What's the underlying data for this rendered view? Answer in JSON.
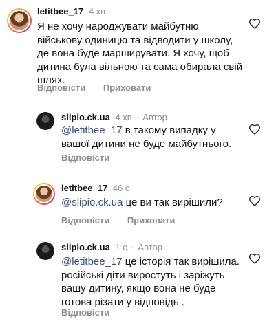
{
  "comments": [
    {
      "username": "letitbee_17",
      "time": "4 хв",
      "author_label": "",
      "text": "Я не хочу народжувати майбутню військову одиницю та відводити у школу, де вона буде марширувати. Я хочу, щоб дитина була вільною та сама обирала свій шлях.",
      "reply": "Відповісти",
      "hide": "Приховати"
    },
    {
      "username": "slipio.ck.ua",
      "time": "4 хв",
      "author_label": "Автор",
      "mention": "@letitbee_17",
      "text": " в такому випадку у вашої дитини не буде майбутнього.",
      "reply": "Відповісти"
    },
    {
      "username": "letitbee_17",
      "time": "46 с",
      "author_label": "",
      "mention": "@slipio.ck.ua",
      "text": " це ви так вирішили?",
      "reply": "Відповісти",
      "hide": "Приховати"
    },
    {
      "username": "slipio.ck.ua",
      "time": "1 с",
      "author_label": "Автор",
      "mention": "@letitbee_17",
      "text": " це історія так вирішила. російські діти виростуть і заріжуть вашу дитину, якщо вона не буде готова різати у відповідь .",
      "reply": "Відповісти"
    }
  ],
  "separator": "·"
}
